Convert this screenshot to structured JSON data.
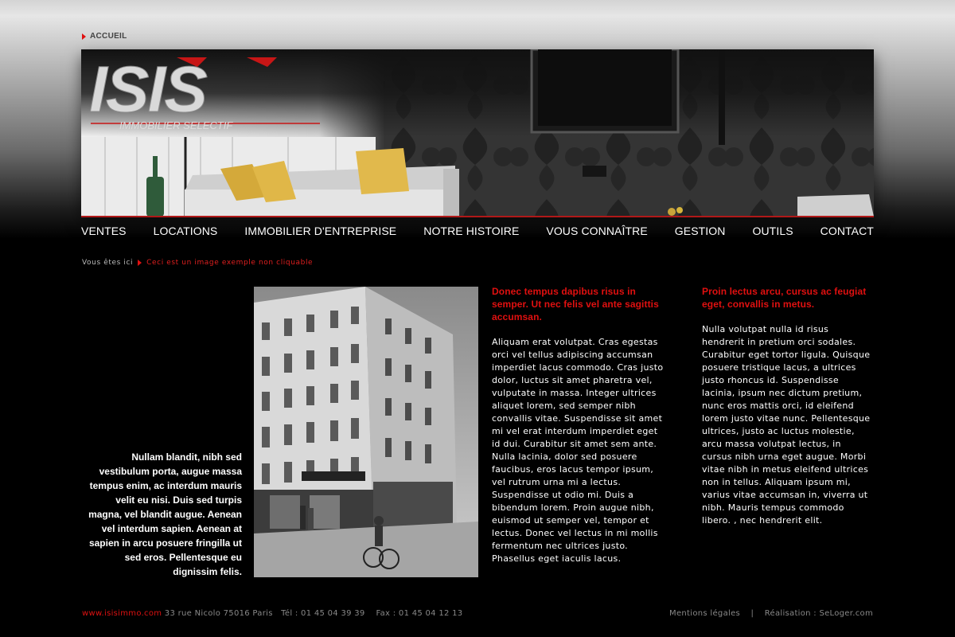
{
  "top_nav": {
    "label": "ACCUEIL"
  },
  "logo": {
    "text": "ISIS",
    "tagline": "IMMOBILIER SELECTIF"
  },
  "main_nav": [
    {
      "label": "VENTES"
    },
    {
      "label": "LOCATIONS"
    },
    {
      "label": "IMMOBILIER D'ENTREPRISE"
    },
    {
      "label": "NOTRE HISTOIRE"
    },
    {
      "label": "VOUS CONNAÎTRE"
    },
    {
      "label": "GESTION"
    },
    {
      "label": "OUTILS"
    },
    {
      "label": "CONTACT"
    }
  ],
  "breadcrumb": {
    "prefix": "Vous êtes ici",
    "current": "Ceci est un image exemple non cliquable"
  },
  "left_text": "Nullam blandit, nibh sed vestibulum porta, augue massa tempus enim, ac interdum mauris velit eu nisi. Duis sed turpis magna, vel blandit augue. Aenean vel interdum sapien. Aenean at sapien in arcu posuere fringilla ut sed eros. Pellentesque eu dignissim felis.",
  "column1": {
    "heading": "Donec tempus dapibus risus in semper. Ut nec felis vel ante sagittis accumsan.",
    "body": "Aliquam erat volutpat. Cras egestas orci vel tellus adipiscing accumsan imperdiet lacus commodo. Cras justo dolor, luctus sit amet pharetra vel, vulputate in massa. Integer ultrices aliquet lorem, sed semper nibh convallis vitae. Suspendisse sit amet mi vel erat interdum imperdiet eget id dui. Curabitur sit amet sem ante. Nulla lacinia, dolor sed posuere faucibus, eros lacus tempor ipsum, vel rutrum urna mi a lectus. Suspendisse ut odio mi. Duis a bibendum lorem. Proin augue nibh, euismod ut semper vel, tempor et lectus. Donec vel lectus in mi mollis fermentum nec ultrices justo. Phasellus eget iaculis lacus."
  },
  "column2": {
    "heading": "Proin lectus arcu, cursus ac feugiat eget, convallis in metus.",
    "body": "Nulla volutpat nulla id risus hendrerit in pretium orci sodales. Curabitur eget tortor ligula. Quisque posuere tristique lacus, a ultrices justo rhoncus id. Suspendisse lacinia, ipsum nec dictum pretium, nunc eros mattis orci, id eleifend lorem justo vitae nunc. Pellentesque ultrices, justo ac luctus molestie, arcu massa volutpat lectus, in cursus nibh urna eget augue. Morbi vitae nibh in metus eleifend ultrices non in tellus. Aliquam ipsum mi, varius vitae accumsan in, viverra ut nibh. Mauris tempus commodo libero. , nec hendrerit elit."
  },
  "footer": {
    "website": "www.isisimmo.com",
    "address": "33 rue Nicolo 75016 Paris",
    "phone": "Tél : 01 45 04 39 39",
    "fax": "Fax : 01 45 04 12 13",
    "legal": "Mentions légales",
    "separator": "|",
    "credit": "Réalisation : SeLoger.com"
  },
  "colors": {
    "accent": "#e01010",
    "background": "#000000"
  },
  "icons": [
    "arrow-right-icon"
  ]
}
